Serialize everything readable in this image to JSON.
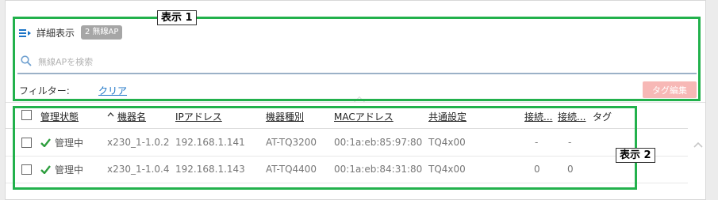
{
  "top": {
    "detail_label": "詳細表示",
    "count_badge": "2 無線AP",
    "search_placeholder": "無線APを検索",
    "filter_label": "フィルター:",
    "clear_link": "クリア",
    "tag_edit_button": "タグ編集"
  },
  "table": {
    "columns": [
      "管理状態",
      "機器名",
      "IPアドレス",
      "機器種別",
      "MACアドレス",
      "共通設定",
      "接続...",
      "接続...",
      "タグ"
    ],
    "rows": [
      {
        "status": "管理中",
        "name": "x230_1-1.0.2",
        "ip": "192.168.1.141",
        "model": "AT-TQ3200",
        "mac": "00:1a:eb:85:97:80",
        "config": "TQ4x00",
        "conn1": "-",
        "conn2": "-",
        "tag": ""
      },
      {
        "status": "管理中",
        "name": "x230_1-1.0.4",
        "ip": "192.168.1.143",
        "model": "AT-TQ4400",
        "mac": "00:1a:eb:84:31:80",
        "config": "TQ4x00",
        "conn1": "0",
        "conn2": "0",
        "tag": ""
      }
    ]
  },
  "annotations": {
    "label1": "表示 1",
    "label2": "表示 2"
  },
  "colors": {
    "accent": "#1a73c6",
    "status_green": "#2e9e3e",
    "tag_button": "#f7b8b6",
    "callout": "#22b14c"
  }
}
